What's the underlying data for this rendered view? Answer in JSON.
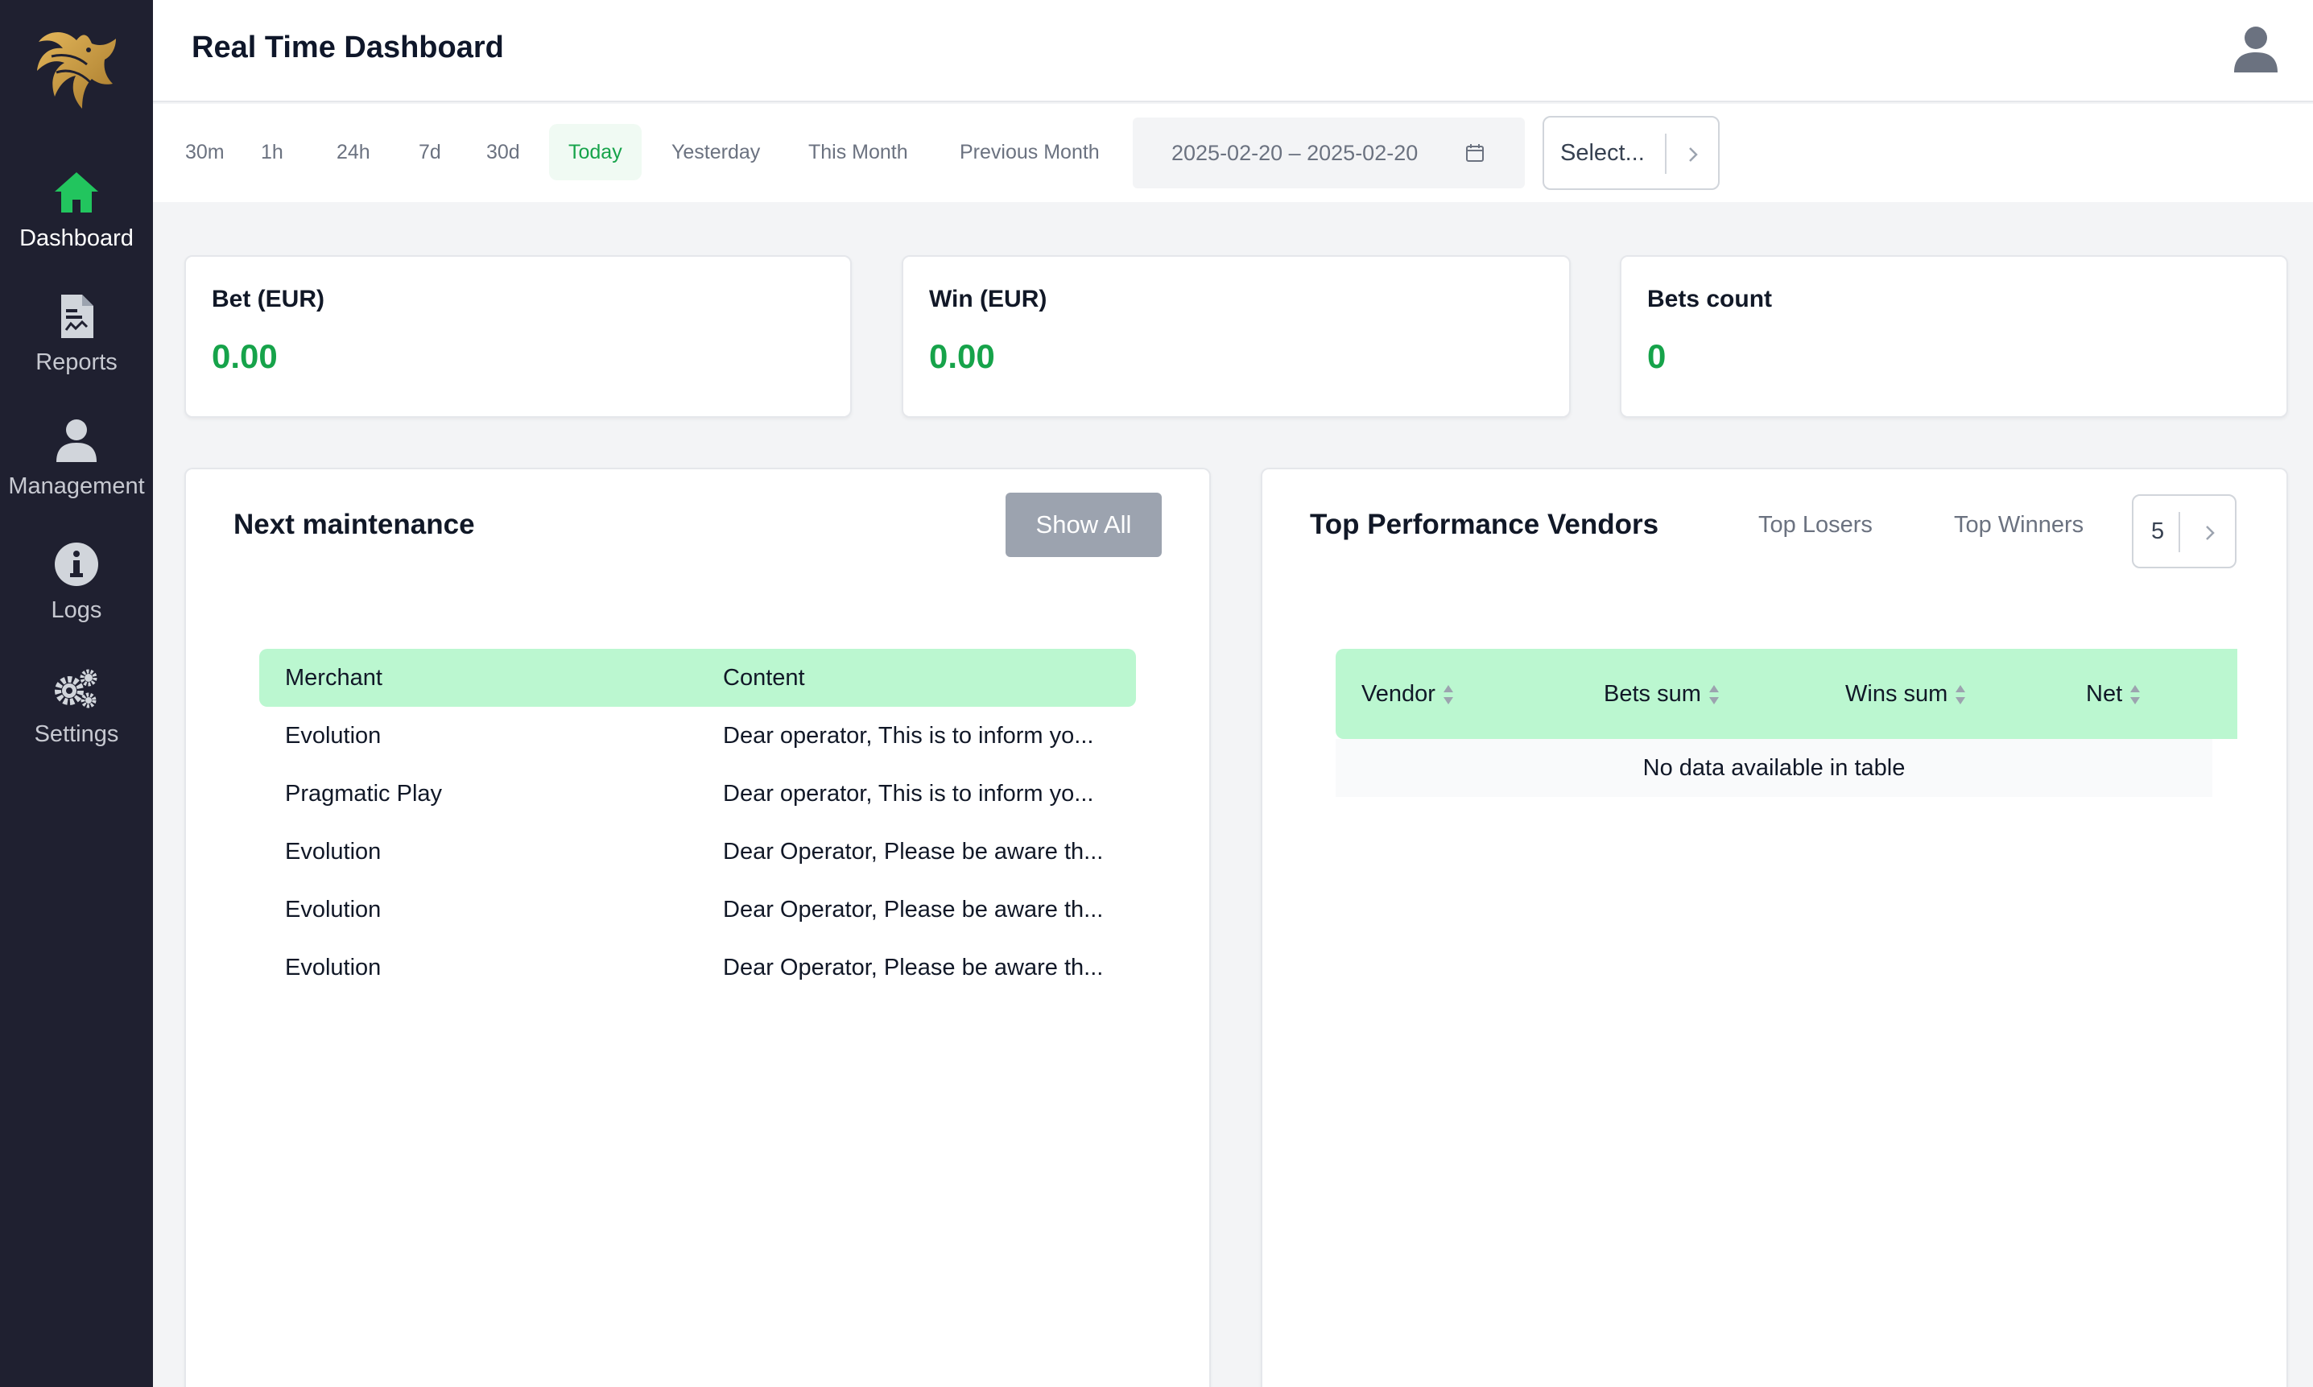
{
  "header": {
    "title": "Real Time Dashboard"
  },
  "sidebar": {
    "items": [
      {
        "label": "Dashboard",
        "icon": "home-icon"
      },
      {
        "label": "Reports",
        "icon": "report-icon"
      },
      {
        "label": "Management",
        "icon": "user-icon"
      },
      {
        "label": "Logs",
        "icon": "info-icon"
      },
      {
        "label": "Settings",
        "icon": "gears-icon"
      }
    ],
    "active_color": "#22c55e",
    "background": "#1f2030"
  },
  "filters": {
    "ranges": [
      "30m",
      "1h",
      "24h",
      "7d",
      "30d",
      "Today",
      "Yesterday",
      "This Month",
      "Previous Month"
    ],
    "active_range": "Today",
    "date_range": "2025-02-20 – 2025-02-20",
    "select_placeholder": "Select..."
  },
  "stats": [
    {
      "title": "Bet (EUR)",
      "value": "0.00"
    },
    {
      "title": "Win (EUR)",
      "value": "0.00"
    },
    {
      "title": "Bets count",
      "value": "0"
    }
  ],
  "maintenance": {
    "title": "Next maintenance",
    "show_all_label": "Show All",
    "columns": [
      "Merchant",
      "Content"
    ],
    "rows": [
      {
        "merchant": "Evolution",
        "content": "Dear operator, This is to inform yo..."
      },
      {
        "merchant": "Pragmatic Play",
        "content": "Dear operator, This is to inform yo..."
      },
      {
        "merchant": "Evolution",
        "content": "Dear Operator, Please be aware th..."
      },
      {
        "merchant": "Evolution",
        "content": "Dear Operator, Please be aware th..."
      },
      {
        "merchant": "Evolution",
        "content": "Dear Operator, Please be aware th..."
      }
    ]
  },
  "vendors": {
    "title": "Top Performance Vendors",
    "tabs": [
      "Top Losers",
      "Top Winners"
    ],
    "count": "5",
    "columns": [
      "Vendor",
      "Bets sum",
      "Wins sum",
      "Net"
    ],
    "empty_text": "No data available in table"
  },
  "colors": {
    "accent": "#16a34a",
    "table_header": "#bbf7d0",
    "button_disabled": "#9ca3af"
  }
}
